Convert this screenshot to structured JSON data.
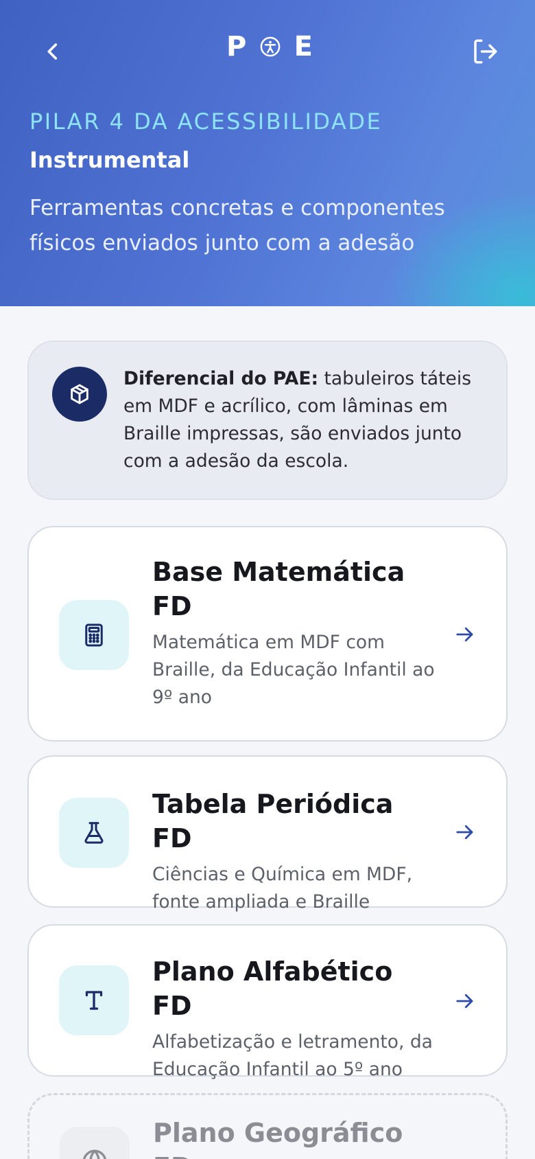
{
  "header": {
    "back_icon": "chevron-left-icon",
    "logo": {
      "left_letter": "P",
      "mark_icon": "accessibility-icon",
      "right_letter": "E"
    },
    "logout_icon": "logout-icon",
    "eyebrow": "PILAR 4 DA ACESSIBILIDADE",
    "title": "Instrumental",
    "description": "Ferramentas concretas e componentes físicos enviados junto com a adesão"
  },
  "note": {
    "icon": "package-icon",
    "strong": "Diferencial do PAE:",
    "text": " tabuleiros táteis em MDF e acrílico, com lâminas em Braille impressas, são enviados junto com a adesão da escola."
  },
  "tools": [
    {
      "icon": "calculator-icon",
      "title": "Base Matemática FD",
      "description": "Matemática em MDF com Braille, da Educação Infantil ao 9º ano"
    },
    {
      "icon": "flask-icon",
      "title": "Tabela Periódica FD",
      "description": "Ciências e Química em MDF, fonte ampliada e Braille"
    },
    {
      "icon": "type-icon",
      "title": "Plano Alfabético FD",
      "description": "Alfabetização e letramento, da Educação Infantil ao 5º ano"
    },
    {
      "icon": "globe-icon",
      "title": "Plano Geográfico FD",
      "description": ""
    }
  ],
  "colors": {
    "header_gradient_start": "#3f62c2",
    "header_gradient_end": "#38bed8",
    "eyebrow": "#8ee3f2",
    "accent_navy": "#1b2b66",
    "icon_tile": "#dff5f8",
    "arrow": "#2e4aa8"
  }
}
